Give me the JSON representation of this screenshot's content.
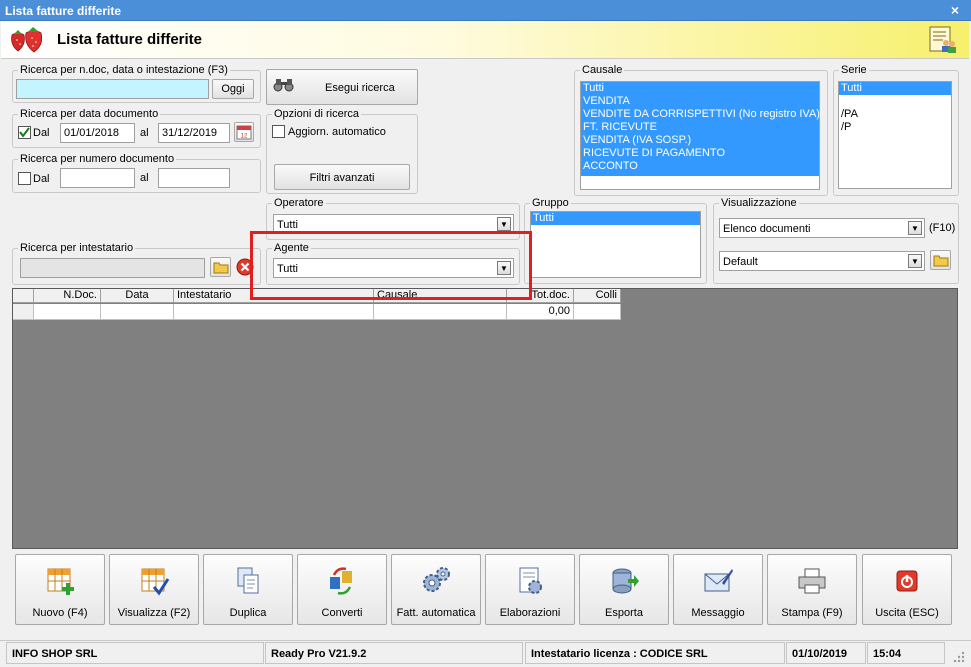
{
  "window": {
    "title": "Lista fatture differite",
    "close_glyph": "×"
  },
  "header": {
    "title": "Lista fatture differite",
    "logo_icon": "strawberry-icon",
    "help_icon": "help-people-icon"
  },
  "search_text": {
    "label": "Ricerca per n.doc, data o intestazione (F3)",
    "value": "",
    "button": "Oggi"
  },
  "search_date": {
    "label": "Ricerca per data documento",
    "from_label": "Dal",
    "checked": true,
    "from": "01/01/2018",
    "to_label": "al",
    "to": "31/12/2019"
  },
  "search_number": {
    "label": "Ricerca per numero documento",
    "from_label": "Dal",
    "checked": false,
    "from": "",
    "to_label": "al",
    "to": ""
  },
  "search_holder": {
    "label": "Ricerca per intestatario",
    "value": ""
  },
  "run_search": {
    "label": "Esegui ricerca"
  },
  "options": {
    "label": "Opzioni di ricerca",
    "auto_update": "Aggiorn. automatico",
    "advanced": "Filtri avanzati"
  },
  "operator": {
    "label": "Operatore",
    "value": "Tutti"
  },
  "agent": {
    "label": "Agente",
    "value": "Tutti"
  },
  "group": {
    "label": "Gruppo",
    "items": [
      "Tutti"
    ]
  },
  "causale": {
    "label": "Causale",
    "items": [
      "Tutti",
      "VENDITA",
      "VENDITE DA CORRISPETTIVI (No registro IVA)",
      "FT. RICEVUTE",
      "VENDITA (IVA SOSP.)",
      "RICEVUTE DI PAGAMENTO",
      "ACCONTO"
    ]
  },
  "serie": {
    "label": "Serie",
    "items": [
      "Tutti",
      "",
      "/PA",
      "/P"
    ]
  },
  "visualizzazione": {
    "label": "Visualizzazione",
    "mode": "Elenco documenti",
    "shortcut": "(F10)",
    "layout": "Default"
  },
  "grid": {
    "columns": [
      "N.Doc.",
      "Data",
      "Intestatario",
      "Causale",
      "Tot.doc.",
      "Colli"
    ],
    "row": [
      "",
      "",
      "",
      "",
      "0,00",
      ""
    ]
  },
  "toolbar": [
    {
      "label": "Nuovo (F4)",
      "icon": "new-grid-icon"
    },
    {
      "label": "Visualizza (F2)",
      "icon": "view-grid-icon"
    },
    {
      "label": "Duplica",
      "icon": "duplicate-icon"
    },
    {
      "label": "Converti",
      "icon": "convert-icon"
    },
    {
      "label": "Fatt. automatica",
      "icon": "gears-icon"
    },
    {
      "label": "Elaborazioni",
      "icon": "process-icon"
    },
    {
      "label": "Esporta",
      "icon": "export-icon"
    },
    {
      "label": "Messaggio",
      "icon": "message-icon"
    },
    {
      "label": "Stampa (F9)",
      "icon": "printer-icon"
    },
    {
      "label": "Uscita (ESC)",
      "icon": "exit-icon"
    }
  ],
  "status": {
    "company": "INFO SHOP SRL",
    "version": "Ready Pro V21.9.2",
    "license": "Intestatario licenza : CODICE SRL",
    "date": "01/10/2019",
    "time": "15:04"
  },
  "colors": {
    "titlebar": "#4a8fd8",
    "selection": "#3399ff",
    "highlight_box": "#e02020",
    "grid_bg": "#808080"
  }
}
